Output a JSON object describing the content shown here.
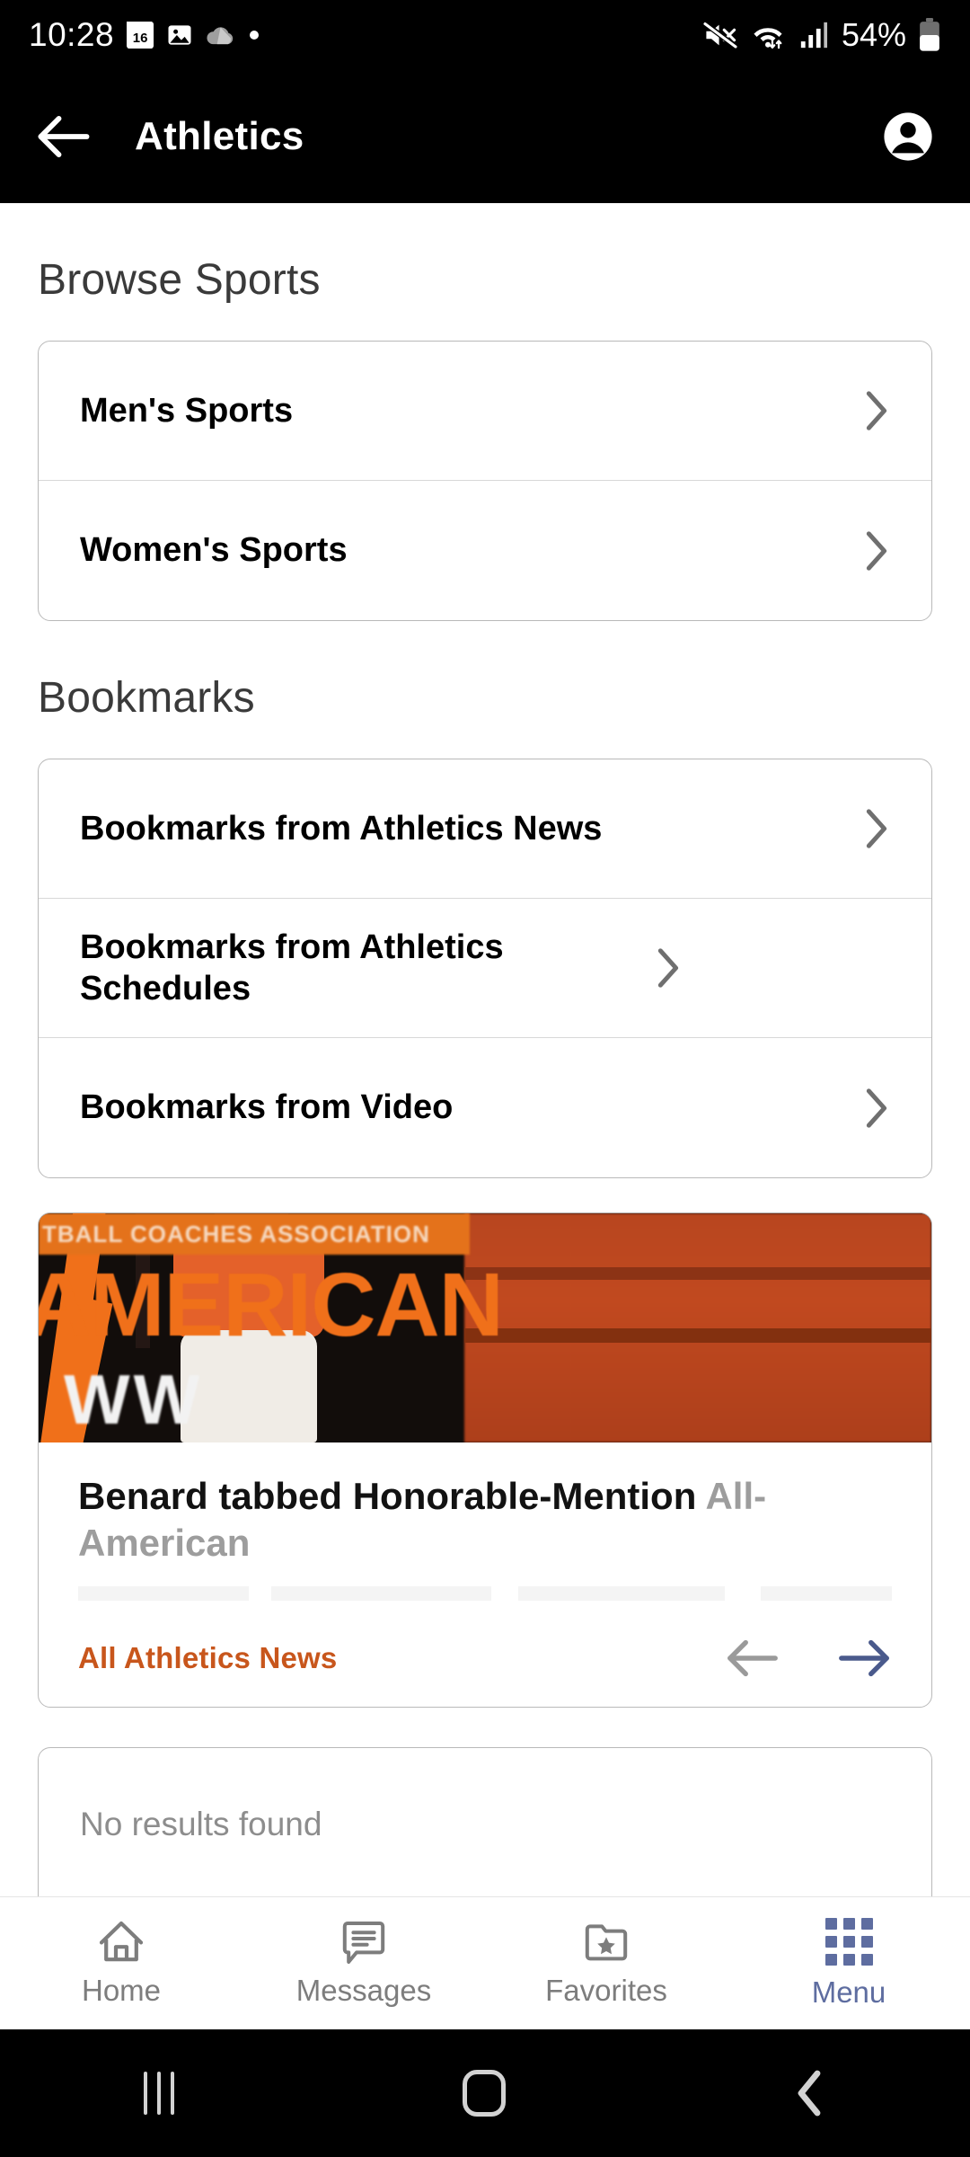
{
  "status_bar": {
    "time": "10:28",
    "calendar_day": "16",
    "battery_percent": "54%",
    "icons": [
      "calendar-icon",
      "image-icon",
      "cloud-icon",
      "dot-icon",
      "mute-icon",
      "wifi-icon",
      "signal-icon",
      "battery-icon"
    ]
  },
  "app_bar": {
    "title": "Athletics",
    "back_label": "back-arrow",
    "account_label": "account"
  },
  "browse_sports": {
    "heading": "Browse Sports",
    "items": [
      {
        "label": "Men's Sports"
      },
      {
        "label": "Women's Sports"
      }
    ]
  },
  "bookmarks": {
    "heading": "Bookmarks",
    "items": [
      {
        "label": "Bookmarks from Athletics News"
      },
      {
        "label": "Bookmarks from Athletics Schedules"
      },
      {
        "label": "Bookmarks from Video"
      }
    ]
  },
  "news_card": {
    "image_banner_top": "TBALL COACHES ASSOCIATION",
    "image_banner_main": "AMERICAN",
    "image_banner_lower": "WW",
    "title_main": "Benard tabbed Honorable-Mention ",
    "title_sub": "All-American",
    "link_label": "All Athletics News",
    "prev_label": "previous",
    "next_label": "next",
    "link_color": "#C8561C",
    "prev_color": "#9a9a9a",
    "next_color": "#4A5A8C"
  },
  "results_card": {
    "message": "No results found"
  },
  "tab_bar": {
    "active": "Menu",
    "active_color": "#5E6DA0",
    "inactive_color": "#7d7d7d",
    "items": [
      {
        "label": "Home",
        "icon": "home-icon"
      },
      {
        "label": "Messages",
        "icon": "messages-icon"
      },
      {
        "label": "Favorites",
        "icon": "favorites-folder-star-icon"
      },
      {
        "label": "Menu",
        "icon": "grid-menu-icon"
      }
    ]
  },
  "android_nav": {
    "recents_label": "recents",
    "home_label": "home",
    "back_label": "back"
  }
}
